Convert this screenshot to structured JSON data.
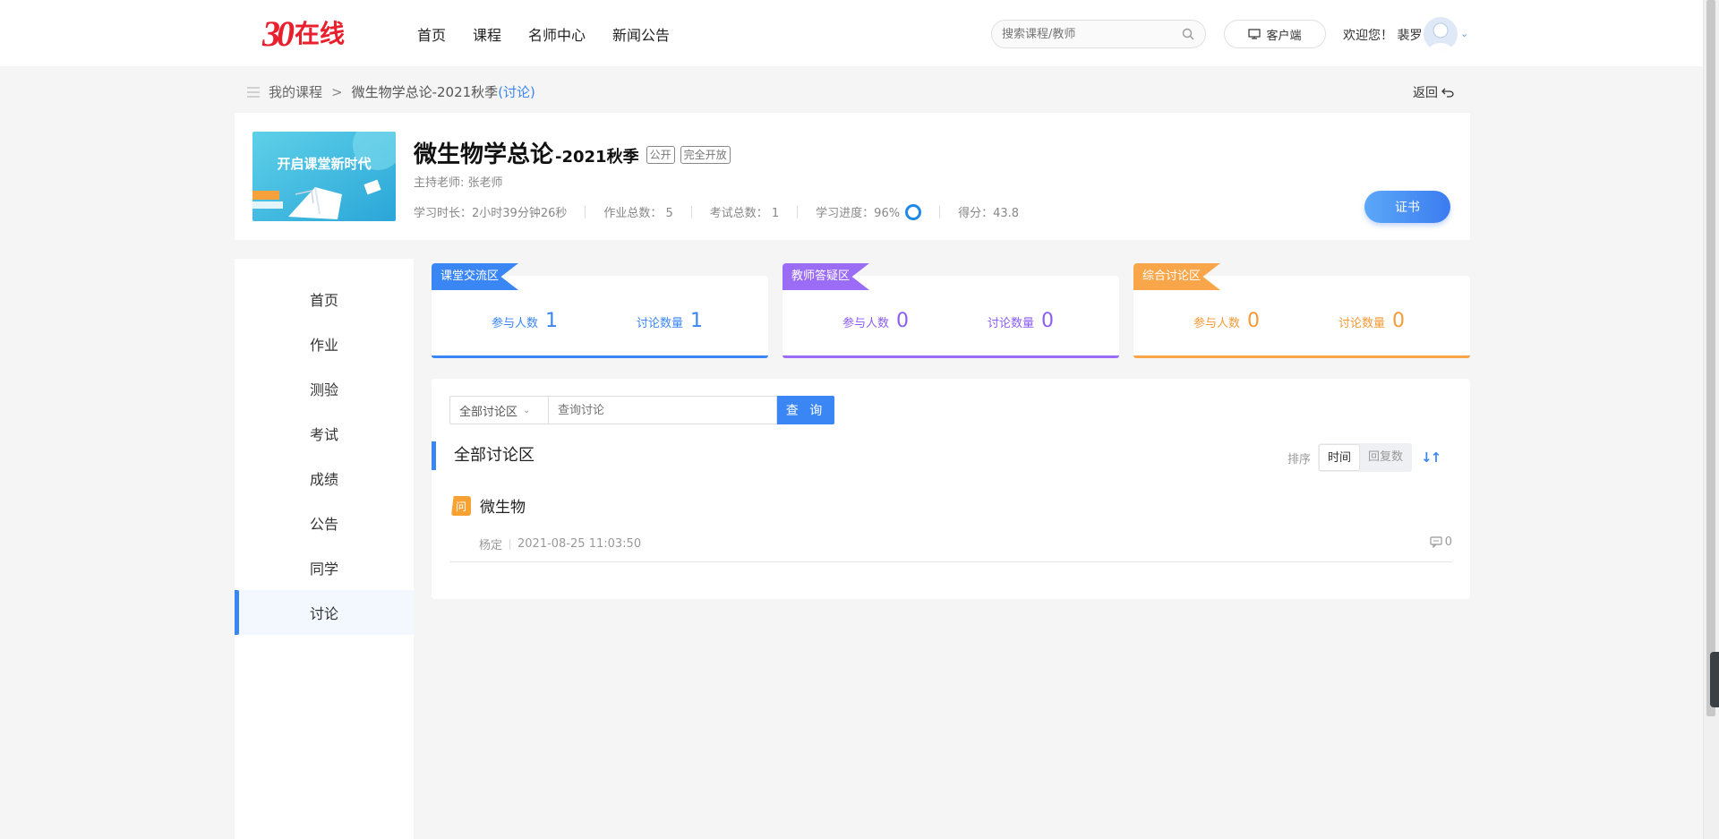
{
  "header": {
    "logo_num": "30",
    "logo_text": "在线",
    "nav": [
      "首页",
      "课程",
      "名师中心",
      "新闻公告"
    ],
    "search_placeholder": "搜索课程/教师",
    "client_button": "客户端",
    "welcome": "欢迎您！ 裴罗"
  },
  "breadcrumb": {
    "root": "我的课程",
    "separator": ">",
    "current": "微生物学总论-2021秋季",
    "highlight": "(讨论)",
    "back": "返回"
  },
  "course": {
    "cover_text": "开启课堂新时代",
    "title": "微生物学总论",
    "term": "-2021秋季",
    "tags": [
      "公开",
      "完全开放"
    ],
    "host": "主持老师: 张老师",
    "stats": {
      "study_time": "学习时长：2小时39分钟26秒",
      "homework": "作业总数：  5",
      "exam": "考试总数：  1",
      "progress": "学习进度：96%",
      "score": "得分：43.8"
    },
    "progress_percent": 96,
    "certificate_button": "证书"
  },
  "sidebar": {
    "items": [
      "首页",
      "作业",
      "测验",
      "考试",
      "成绩",
      "公告",
      "同学",
      "讨论"
    ],
    "active_index": 7
  },
  "zones": [
    {
      "label": "课堂交流区",
      "participants_label": "参与人数",
      "participants": "1",
      "discussions_label": "讨论数量",
      "discussions": "1",
      "color": "#3b86f5"
    },
    {
      "label": "教师答疑区",
      "participants_label": "参与人数",
      "participants": "0",
      "discussions_label": "讨论数量",
      "discussions": "0",
      "color": "#9b6cf5"
    },
    {
      "label": "综合讨论区",
      "participants_label": "参与人数",
      "participants": "0",
      "discussions_label": "讨论数量",
      "discussions": "0",
      "color": "#f9a64a"
    }
  ],
  "discussion": {
    "area_select": "全部讨论区",
    "query_placeholder": "查询讨论",
    "query_button": "查 询",
    "section_title": "全部讨论区",
    "sort_label": "排序",
    "sort_options": [
      "时间",
      "回复数"
    ],
    "sort_active": "时间",
    "posts": [
      {
        "badge": "问",
        "title": "微生物",
        "author": "杨定",
        "time": "2021-08-25 11:03:50",
        "replies": "0"
      }
    ]
  }
}
